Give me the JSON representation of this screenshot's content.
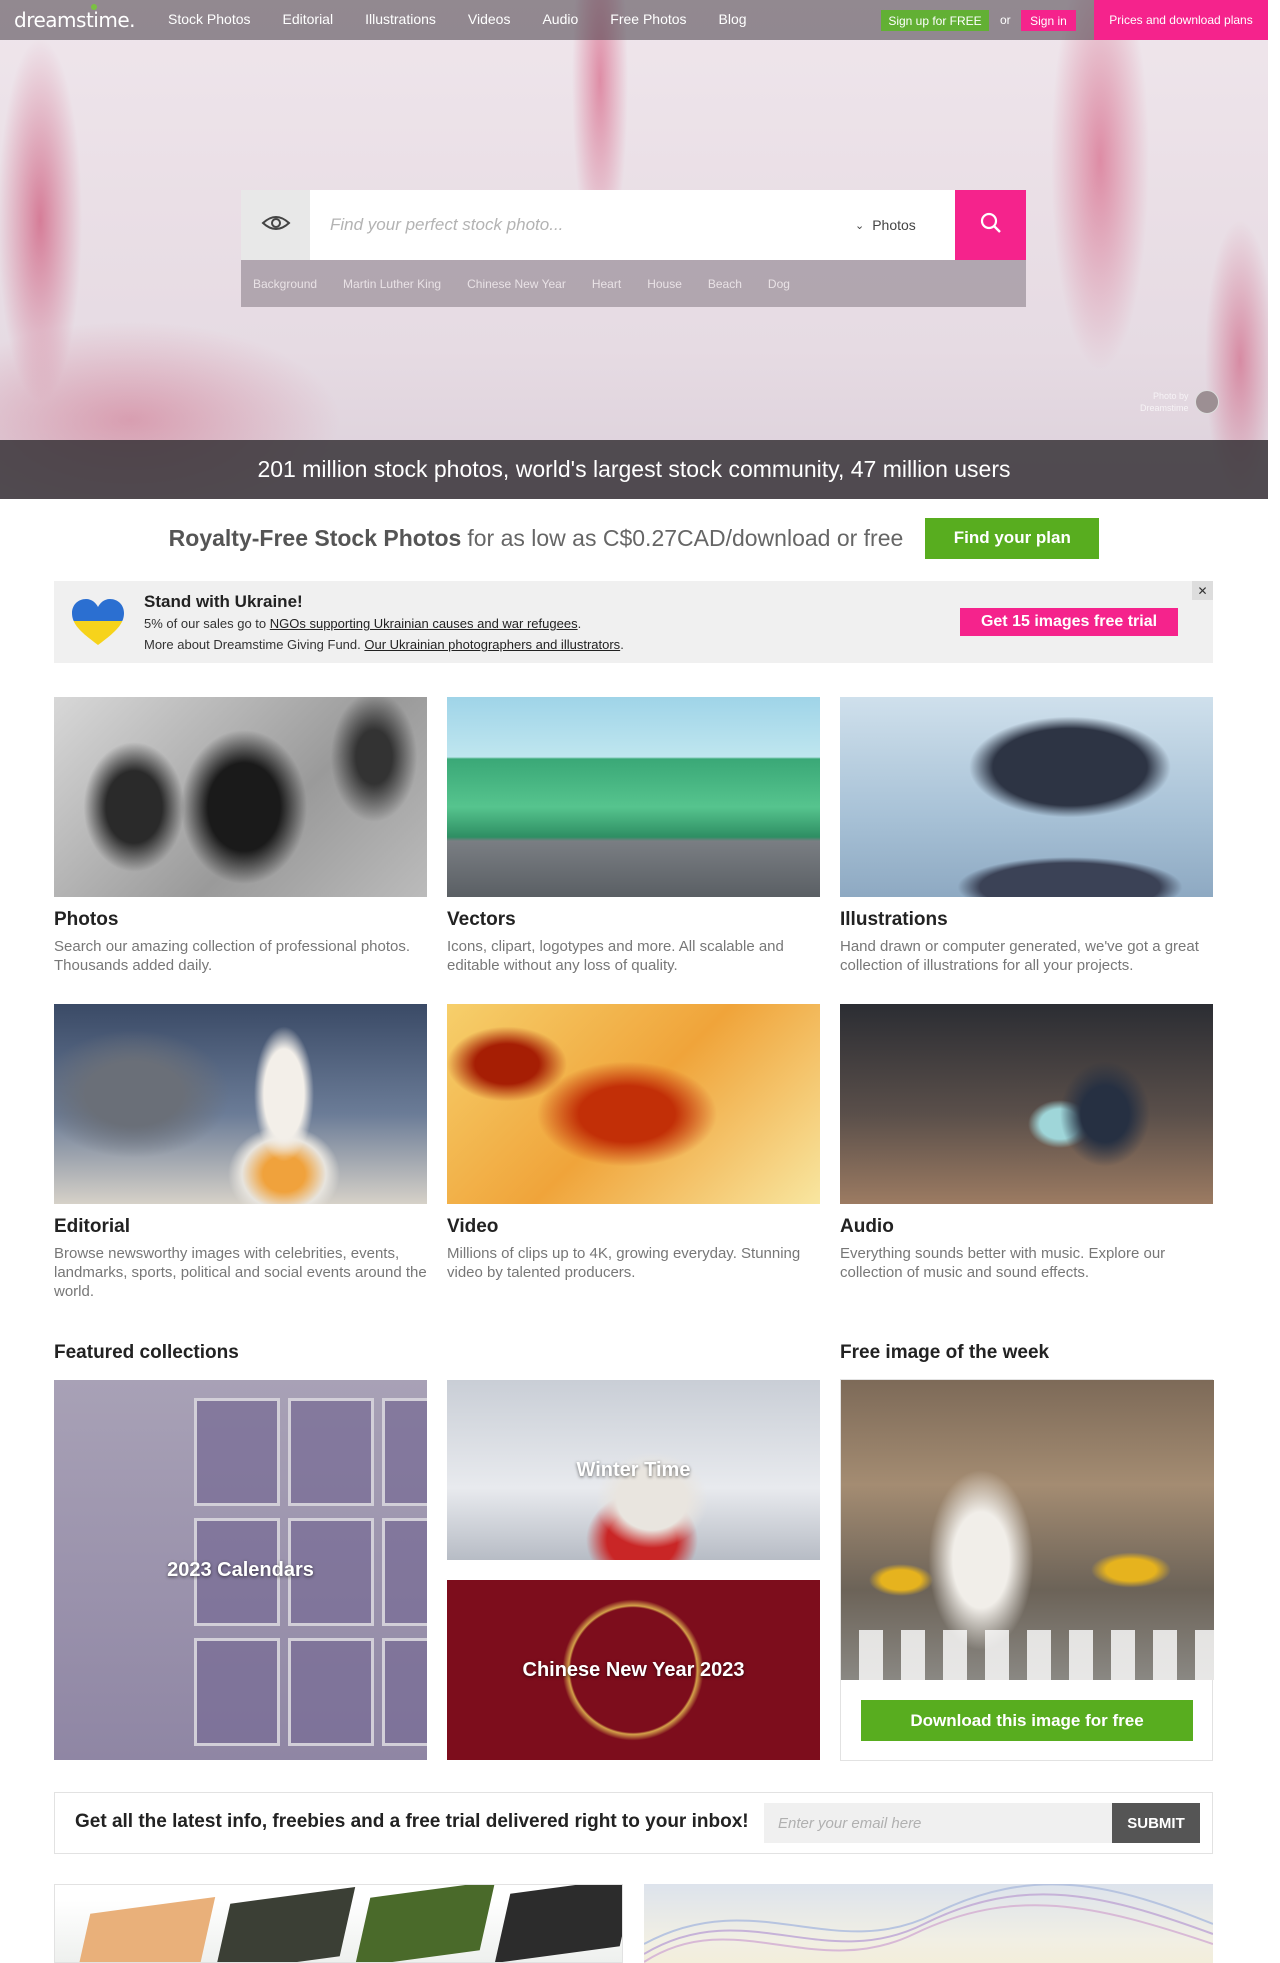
{
  "nav": {
    "logo": "dreamstime.",
    "links": [
      "Stock Photos",
      "Editorial",
      "Illustrations",
      "Videos",
      "Audio",
      "Free Photos",
      "Blog"
    ],
    "signup": "Sign up for FREE",
    "or": "or",
    "signin": "Sign in",
    "prices": "Prices and download plans"
  },
  "search": {
    "placeholder": "Find your perfect stock photo...",
    "type": "Photos",
    "suggestions": [
      "Background",
      "Martin Luther King",
      "Chinese New Year",
      "Heart",
      "House",
      "Beach",
      "Dog"
    ]
  },
  "hero": {
    "stats": "201 million stock photos, world's largest stock community, 47 million users",
    "credit_line1": "Photo by",
    "credit_line2": "Dreamstime"
  },
  "royalty": {
    "bold": "Royalty-Free Stock Photos",
    "rest": "for as low as C$0.27CAD/download or free",
    "button": "Find your plan"
  },
  "ukraine": {
    "title": "Stand with Ukraine!",
    "line1_prefix": "5% of our sales go to ",
    "line1_link": "NGOs supporting Ukrainian causes and war refugees",
    "line1_suffix": ".",
    "line2_prefix": "More about Dreamstime Giving Fund. ",
    "line2_link": "Our Ukrainian photographers and illustrators",
    "line2_suffix": ".",
    "button": "Get 15 images free trial",
    "close": "✕"
  },
  "categories": [
    {
      "title": "Photos",
      "desc": "Search our amazing collection of professional photos. Thousands added daily."
    },
    {
      "title": "Vectors",
      "desc": "Icons, clipart, logotypes and more. All scalable and editable without any loss of quality."
    },
    {
      "title": "Illustrations",
      "desc": "Hand drawn or computer generated, we've got a great collection of illustrations for all your projects."
    },
    {
      "title": "Editorial",
      "desc": "Browse newsworthy images with celebrities, events, landmarks, sports, political and social events around the world."
    },
    {
      "title": "Video",
      "desc": "Millions of clips up to 4K, growing everyday. Stunning video by talented producers."
    },
    {
      "title": "Audio",
      "desc": "Everything sounds better with music. Explore our collection of music and sound effects."
    }
  ],
  "featured": {
    "title": "Featured collections",
    "items": [
      "2023 Calendars",
      "Winter Time",
      "Chinese New Year 2023"
    ]
  },
  "free_week": {
    "title": "Free image of the week",
    "button": "Download this image for free"
  },
  "newsletter": {
    "text": "Get all the latest info, freebies and a free trial delivered right to your inbox!",
    "placeholder": "Enter your email here",
    "button": "SUBMIT"
  },
  "colors": {
    "pink": "#f5238c",
    "green": "#58ad1f",
    "nav_green": "#62b034"
  }
}
